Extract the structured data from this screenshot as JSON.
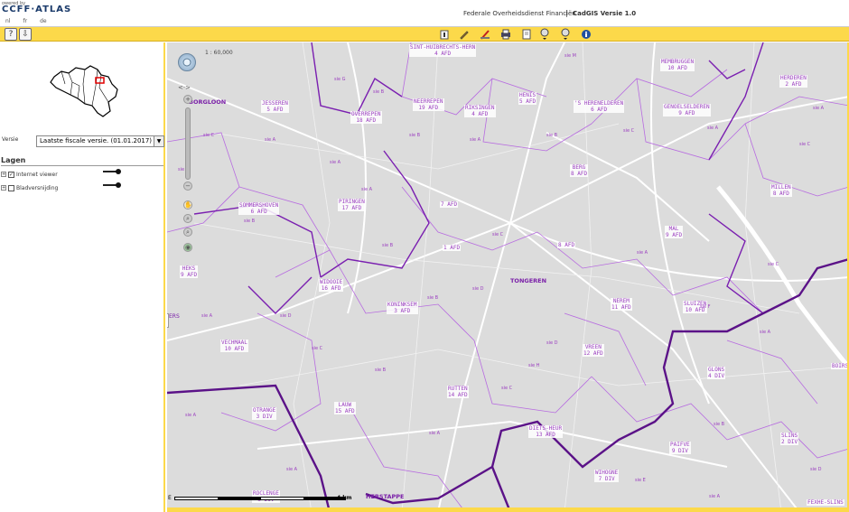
{
  "header": {
    "powered_by": "owered by",
    "logo": "CCFF·ATLAS",
    "languages": [
      "nl",
      "fr",
      "de"
    ],
    "agency": "Federale Overheidsdienst Financiën",
    "separator": "|",
    "app_name": "CadGIS   Versie   1.0"
  },
  "toolbar": {
    "help_icon": "help-icon",
    "download_icon": "download-icon",
    "tools": [
      "info-icon",
      "pencil-icon",
      "measure-icon",
      "print-icon",
      "document-icon",
      "search-parcel-icon",
      "search-address-icon",
      "about-icon"
    ]
  },
  "left_panel": {
    "versie_label": "Versie",
    "versie_value": "Laatste fiscale versie. (01.01.2017)",
    "lagen_title": "Lagen",
    "layers": [
      {
        "name": "Internet viewer",
        "checked": true
      },
      {
        "name": "Bladversnijding",
        "checked": false
      }
    ]
  },
  "map": {
    "scale_text": "1 : 60,000",
    "scale_label": "4 km",
    "scale_start": "E",
    "left_edge_label": "ERS",
    "colors": {
      "boundary_major": "#6a1a9a",
      "boundary_minor": "#9b3fc0",
      "water": "#c8d8e8",
      "land": "#dcdcdc",
      "accent": "#fcd94a"
    },
    "towns": [
      "BORGLOON",
      "TONGEREN",
      "HERSTAPPE"
    ],
    "labels": [
      {
        "name": "SINT-HUIBRECHTS-HERN",
        "sub": "4 AFD"
      },
      {
        "name": "MEMBRUGGEN",
        "sub": "10 AFD"
      },
      {
        "name": "HERDEREN",
        "sub": "2 AFD"
      },
      {
        "name": "JESSEREN",
        "sub": "5 AFD"
      },
      {
        "name": "OVERREPEN",
        "sub": "18 AFD"
      },
      {
        "name": "NEERREPEN",
        "sub": "19 AFD"
      },
      {
        "name": "RIKSINGEN",
        "sub": "4 AFD"
      },
      {
        "name": "HENIS",
        "sub": "5 AFD"
      },
      {
        "name": "'S HERENELDEREN",
        "sub": "6 AFD"
      },
      {
        "name": "GENOELSELDEREN",
        "sub": "9 AFD"
      },
      {
        "name": "BERG",
        "sub": "8 AFD"
      },
      {
        "name": "MILLEN",
        "sub": "8 AFD"
      },
      {
        "name": "SOMMERSHOVEN",
        "sub": "6 AFD"
      },
      {
        "name": "PIRINGEN",
        "sub": "17 AFD"
      },
      {
        "name": "",
        "sub": "7 AFD"
      },
      {
        "name": "MAL",
        "sub": "9 AFD"
      },
      {
        "name": "",
        "sub": "1 AFD"
      },
      {
        "name": "",
        "sub": "8 AFD"
      },
      {
        "name": "HEKS",
        "sub": "9 AFD"
      },
      {
        "name": "WIDOOIE",
        "sub": "16 AFD"
      },
      {
        "name": "KONINKSEM",
        "sub": "3 AFD"
      },
      {
        "name": "NEREM",
        "sub": "11 AFD"
      },
      {
        "name": "SLUIZEN",
        "sub": "10 AFD"
      },
      {
        "name": "VECHMAAL",
        "sub": "10 AFD"
      },
      {
        "name": "VREEN",
        "sub": "12 AFD"
      },
      {
        "name": "GLONS",
        "sub": "4 DIV"
      },
      {
        "name": "LAUW",
        "sub": "15 AFD"
      },
      {
        "name": "RUTTEN",
        "sub": "14 AFD"
      },
      {
        "name": "OTRANGE",
        "sub": "3 DIV"
      },
      {
        "name": "DIETS-HEUR",
        "sub": "13 AFD"
      },
      {
        "name": "PAIFVE",
        "sub": "9 DIV"
      },
      {
        "name": "SLINS",
        "sub": "2 DIV"
      },
      {
        "name": "WIHOGNE",
        "sub": "7 DIV"
      },
      {
        "name": "ROCLENGE",
        "sub": "3 DIV"
      },
      {
        "name": "FEXHE-SLINS",
        "sub": ""
      },
      {
        "name": "BOIRS",
        "sub": ""
      }
    ],
    "section_marks": [
      "sie A",
      "sie B",
      "sie C",
      "sie D",
      "sie E",
      "sie F",
      "sie G",
      "sie H",
      "sie M"
    ]
  }
}
